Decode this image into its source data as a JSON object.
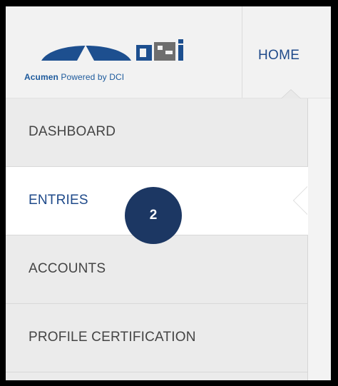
{
  "brand": {
    "logo_mark": "DCI",
    "tagline_brand": "Acumen",
    "tagline_rest": " Powered by DCI",
    "colors": {
      "brand_blue": "#1d5a9c",
      "dark_navy": "#1c3763"
    }
  },
  "header": {
    "home_tab": "HOME"
  },
  "sidebar": {
    "items": [
      {
        "label": "DASHBOARD",
        "active": false
      },
      {
        "label": "ENTRIES",
        "active": true
      },
      {
        "label": "ACCOUNTS",
        "active": false
      },
      {
        "label": "PROFILE CERTIFICATION",
        "active": false
      }
    ]
  },
  "step_badge": {
    "number": "2"
  }
}
